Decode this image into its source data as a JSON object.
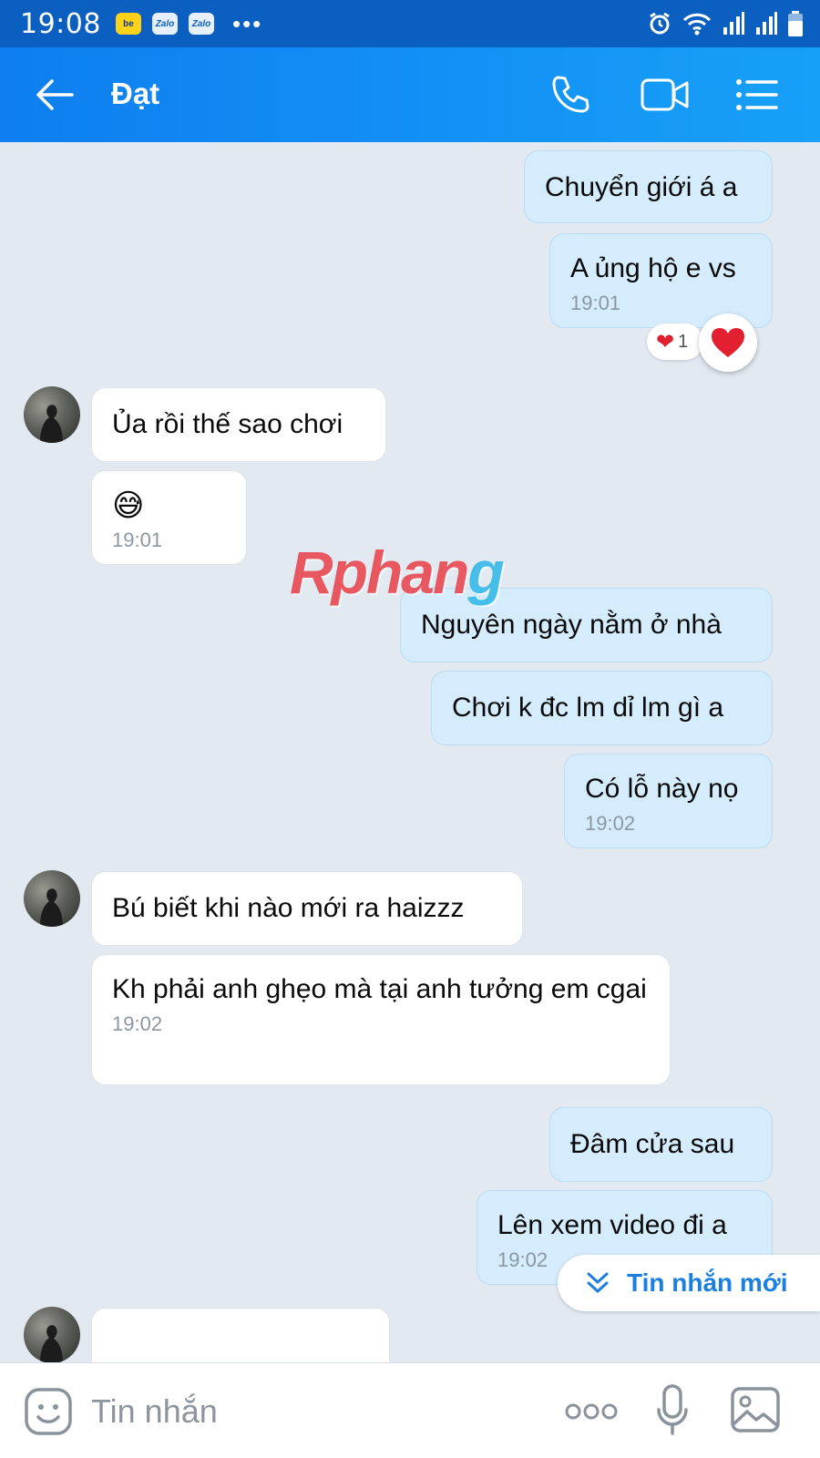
{
  "status_bar": {
    "time": "19:08",
    "apps": [
      {
        "label": "be",
        "icon": "be-app-icon"
      },
      {
        "label": "Zalo",
        "icon": "zalo-app-icon"
      },
      {
        "label": "Zalo",
        "icon": "zalo-app-icon"
      }
    ],
    "overflow": "•••"
  },
  "header": {
    "contact_name": "Đạt",
    "icons": [
      "back-arrow-icon",
      "phone-icon",
      "video-call-icon",
      "menu-list-icon"
    ]
  },
  "messages": [
    {
      "sender": "me",
      "text": "Chuyển giới á a"
    },
    {
      "sender": "me",
      "text": "A ủng hộ e vs",
      "time": "19:01",
      "reaction": {
        "emoji": "❤",
        "count": "1"
      }
    },
    {
      "sender": "them",
      "text": "Ủa rồi thế sao chơi"
    },
    {
      "sender": "them",
      "text": "😅",
      "time": "19:01"
    },
    {
      "sender": "me",
      "text": "Nguyên ngày nằm ở nhà"
    },
    {
      "sender": "me",
      "text": "Chơi k đc lm dỉ lm gì a"
    },
    {
      "sender": "me",
      "text": "Có lỗ này nọ",
      "time": "19:02"
    },
    {
      "sender": "them",
      "text": "Bú biết khi nào mới ra haizzz"
    },
    {
      "sender": "them",
      "text": "Kh phải anh ghẹo mà tại anh tưởng em cgai",
      "time": "19:02"
    },
    {
      "sender": "me",
      "text": "Đâm cửa sau"
    },
    {
      "sender": "me",
      "text": "Lên xem video đi a",
      "time": "19:02"
    }
  ],
  "watermark": {
    "part1": "Rphan",
    "part2": "g"
  },
  "new_messages_label": "Tin nhắn mới",
  "input": {
    "placeholder": "Tin nhắn"
  },
  "colors": {
    "header_gradient_start": "#0e7ef0",
    "header_gradient_end": "#17a0f8",
    "status_bar": "#0b5fc1",
    "chat_background": "#e2e9f1",
    "my_bubble": "#d5ecfc",
    "their_bubble": "#ffffff",
    "accent": "#1a7fe0"
  }
}
